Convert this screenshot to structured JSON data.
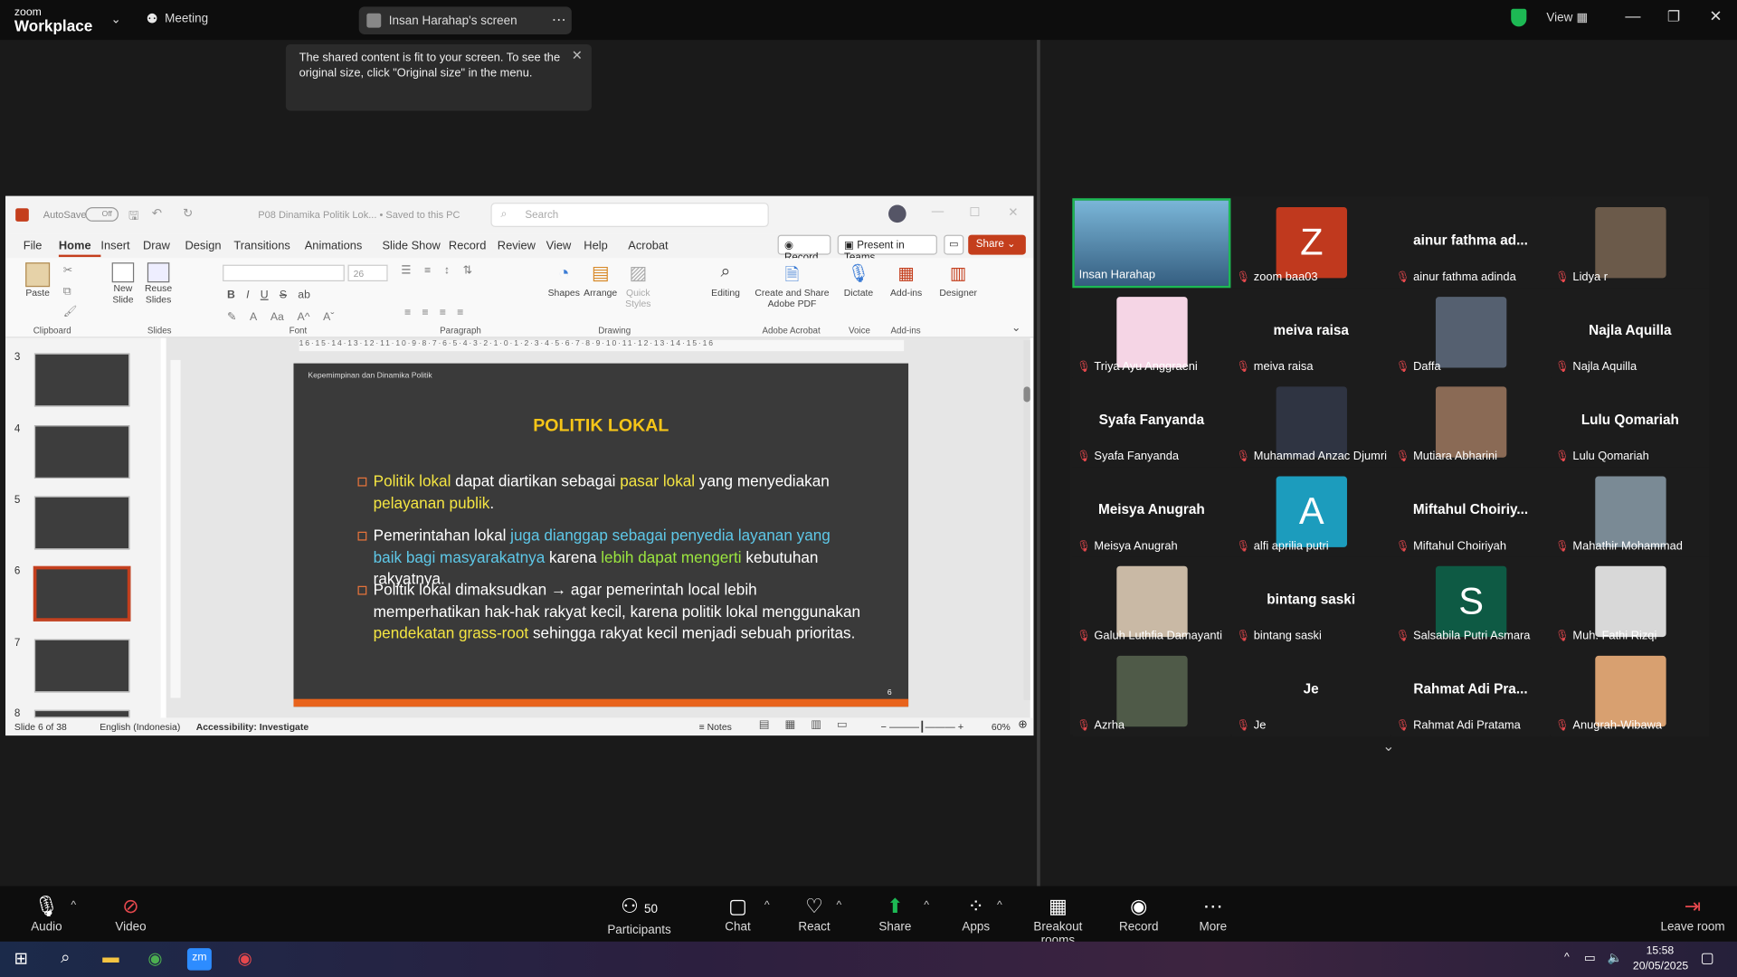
{
  "topbar": {
    "brand_small": "zoom",
    "brand_large": "Workplace",
    "meeting_label": "Meeting",
    "screen_label": "Insan Harahap's screen",
    "view_label": "View"
  },
  "tooltip": {
    "text": "The shared content is fit to your screen. To see the original size, click \"Original size\" in the menu."
  },
  "ppt": {
    "autosave": "AutoSave",
    "autosave_state": "Off",
    "filename": "P08 Dinamika Politik Lok... • Saved to this PC",
    "search_placeholder": "Search",
    "tabs": [
      "File",
      "Home",
      "Insert",
      "Draw",
      "Design",
      "Transitions",
      "Animations",
      "Slide Show",
      "Record",
      "Review",
      "View",
      "Help",
      "Acrobat"
    ],
    "btn_record": "Record",
    "btn_teams": "Present in Teams",
    "btn_share": "Share",
    "ribbon": {
      "paste": "Paste",
      "clipboard": "Clipboard",
      "new_slide": "New Slide",
      "reuse": "Reuse Slides",
      "slides": "Slides",
      "font": "Font",
      "font_size": "26",
      "paragraph": "Paragraph",
      "shapes": "Shapes",
      "arrange": "Arrange",
      "quick_styles": "Quick Styles",
      "drawing": "Drawing",
      "editing": "Editing",
      "create_pdf": "Create and Share Adobe PDF",
      "adobe": "Adobe Acrobat",
      "dictate": "Dictate",
      "voice": "Voice",
      "addins": "Add-ins",
      "addins_grp": "Add-ins",
      "designer": "Designer"
    },
    "thumb_numbers": [
      "3",
      "4",
      "5",
      "6",
      "7",
      "8"
    ],
    "slide": {
      "header": "Kepemimpinan dan Dinamika Politik",
      "title": "POLITIK LOKAL",
      "page": "6",
      "b1": [
        "Politik lokal",
        " dapat diartikan sebagai ",
        "pasar lokal",
        " yang menyediakan ",
        "pelayanan publik",
        "."
      ],
      "b2": [
        "Pemerintahan lokal ",
        "juga dianggap sebagai penyedia layanan yang baik bagi masyarakatnya",
        " karena ",
        "lebih dapat mengerti",
        " kebutuhan rakyatnya."
      ],
      "b3": [
        "Politik lokal dimaksudkan  → agar pemerintah local lebih memperhatikan hak-hak rakyat kecil, karena politik lokal menggunakan ",
        "pendekatan grass-root",
        " sehingga rakyat kecil menjadi sebuah prioritas."
      ]
    },
    "status": {
      "slide_of": "Slide 6 of 38",
      "language": "English (Indonesia)",
      "accessibility": "Accessibility: Investigate",
      "notes": "Notes",
      "zoom": "60%"
    }
  },
  "participants": [
    {
      "name": "Insan Harahap",
      "big": "",
      "avatar": "video",
      "color": "#4a7a9c"
    },
    {
      "name": "zoom baa03",
      "big": "",
      "avatar": "Z",
      "color": "#c0391e"
    },
    {
      "name": "ainur fathma adinda",
      "big": "ainur fathma ad...",
      "avatar": "",
      "color": ""
    },
    {
      "name": "Lidya r",
      "big": "",
      "avatar": "photo",
      "color": "#6b5a4a"
    },
    {
      "name": "Triya Ayu Anggraeni",
      "big": "",
      "avatar": "heart",
      "color": "#f5d5e5"
    },
    {
      "name": "meiva raisa",
      "big": "meiva raisa",
      "avatar": "",
      "color": ""
    },
    {
      "name": "Daffa",
      "big": "",
      "avatar": "photo",
      "color": "#556070"
    },
    {
      "name": "Najla Aquilla",
      "big": "Najla Aquilla",
      "avatar": "",
      "color": ""
    },
    {
      "name": "Syafa Fanyanda",
      "big": "Syafa Fanyanda",
      "avatar": "",
      "color": ""
    },
    {
      "name": "Muhammad Anzac Djumri",
      "big": "",
      "avatar": "sig",
      "color": "#2f3442"
    },
    {
      "name": "Mutiara Abharini",
      "big": "",
      "avatar": "photo",
      "color": "#8a6a55"
    },
    {
      "name": "Lulu  Qomariah",
      "big": "Lulu  Qomariah",
      "avatar": "",
      "color": ""
    },
    {
      "name": "Meisya Anugrah",
      "big": "Meisya Anugrah",
      "avatar": "",
      "color": ""
    },
    {
      "name": "alfi aprilia putri",
      "big": "",
      "avatar": "A",
      "color": "#1c9cbd"
    },
    {
      "name": "Miftahul Choiriyah",
      "big": "Miftahul  Choiriy...",
      "avatar": "",
      "color": ""
    },
    {
      "name": "Mahathir Mohammad",
      "big": "",
      "avatar": "photo",
      "color": "#7a8a95"
    },
    {
      "name": "Galuh Luthfia Damayanti",
      "big": "",
      "avatar": "photo",
      "color": "#c9b9a5"
    },
    {
      "name": "bintang saski",
      "big": "bintang saski",
      "avatar": "",
      "color": ""
    },
    {
      "name": "Salsabila Putri Asmara",
      "big": "",
      "avatar": "S",
      "color": "#0e5a44"
    },
    {
      "name": "Muh. Fathi Rizqi",
      "big": "",
      "avatar": "photo",
      "color": "#d8d8d8"
    },
    {
      "name": "Azrha",
      "big": "",
      "avatar": "photo",
      "color": "#4f5a48"
    },
    {
      "name": "Je",
      "big": "Je",
      "avatar": "",
      "color": ""
    },
    {
      "name": "Rahmat Adi Pratama",
      "big": "Rahmat Adi Pra...",
      "avatar": "",
      "color": ""
    },
    {
      "name": "Anugrah-Wibawa",
      "big": "",
      "avatar": "photo",
      "color": "#d8a070"
    }
  ],
  "bottombar": {
    "audio": "Audio",
    "video": "Video",
    "participants": "Participants",
    "participants_count": "50",
    "chat": "Chat",
    "react": "React",
    "share": "Share",
    "apps": "Apps",
    "breakout": "Breakout rooms",
    "record": "Record",
    "more": "More",
    "leave": "Leave room"
  },
  "taskbar": {
    "time": "15:58",
    "date": "20/05/2025"
  }
}
